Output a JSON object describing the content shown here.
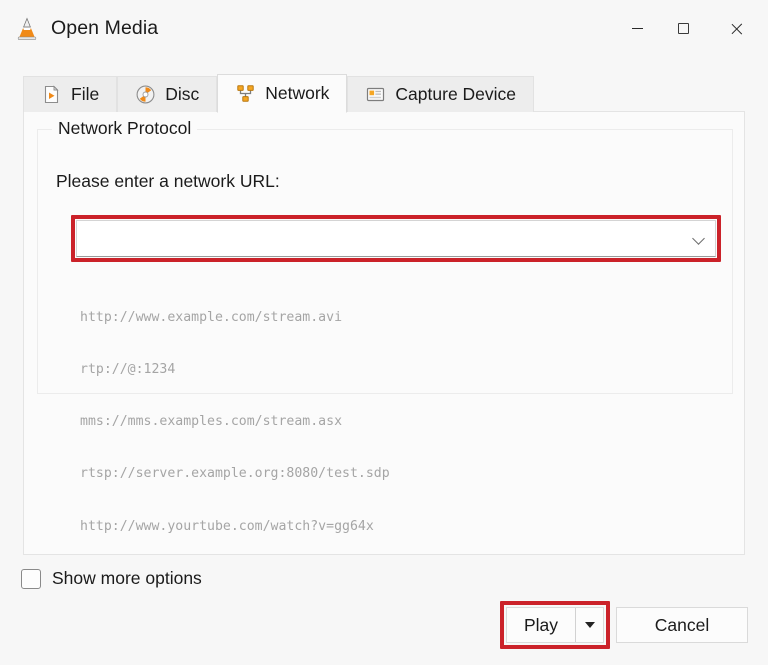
{
  "window": {
    "title": "Open Media",
    "app_icon": "vlc-cone-icon",
    "controls": {
      "minimize": "minimize-icon",
      "maximize": "maximize-icon",
      "close": "close-icon"
    }
  },
  "tabs": [
    {
      "label": "File",
      "icon": "file-play-icon",
      "active": false
    },
    {
      "label": "Disc",
      "icon": "disc-icon",
      "active": false
    },
    {
      "label": "Network",
      "icon": "network-icon",
      "active": true
    },
    {
      "label": "Capture Device",
      "icon": "capture-card-icon",
      "active": false
    }
  ],
  "network_panel": {
    "group_label": "Network Protocol",
    "url_prompt": "Please enter a network URL:",
    "url_value": "",
    "url_placeholder": "",
    "dropdown_icon": "chevron-down-icon",
    "examples": [
      "http://www.example.com/stream.avi",
      "rtp://@:1234",
      "mms://mms.examples.com/stream.asx",
      "rtsp://server.example.org:8080/test.sdp",
      "http://www.yourtube.com/watch?v=gg64x"
    ]
  },
  "footer": {
    "show_more_options_label": "Show more options",
    "show_more_options_checked": false,
    "play_label": "Play",
    "play_dropdown_icon": "caret-down-icon",
    "cancel_label": "Cancel"
  },
  "annotations": {
    "highlight_color": "#cb2229",
    "highlighted_elements": [
      "url-combobox",
      "play-button"
    ]
  },
  "colors": {
    "accent_orange": "#f08a18",
    "window_background": "#f7f7f7",
    "panel_background": "#fbfbfb",
    "example_text": "#a5a5a5"
  }
}
